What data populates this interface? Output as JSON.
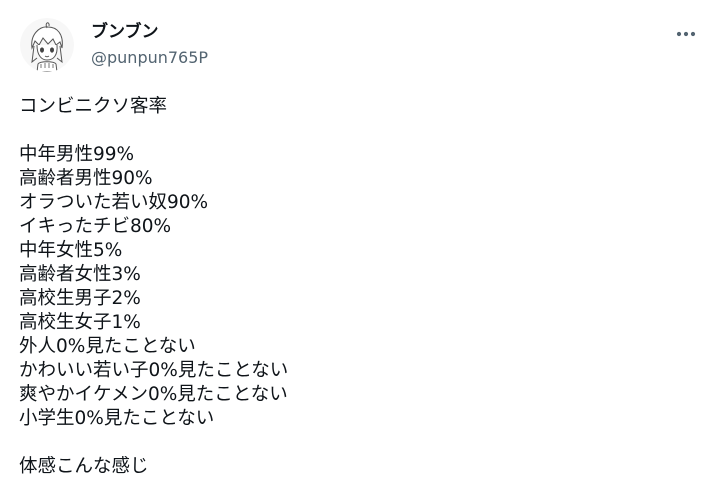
{
  "author": {
    "name": "ブンブン",
    "handle": "@punpun765P"
  },
  "menu": {
    "more_icon": "more-horizontal-icon"
  },
  "tweet": {
    "lines": [
      "コンビニクソ客率",
      "",
      "中年男性99%",
      "高齢者男性90%",
      "オラついた若い奴90%",
      "イキったチビ80%",
      "中年女性5%",
      "高齢者女性3%",
      "高校生男子2%",
      "高校生女子1%",
      "外人0%見たことない",
      "かわいい若い子0%見たことない",
      "爽やかイケメン0%見たことない",
      "小学生0%見たことない",
      "",
      "体感こんな感じ"
    ]
  },
  "colors": {
    "text": "#0f1419",
    "secondary_text": "#536471",
    "background": "#ffffff"
  }
}
